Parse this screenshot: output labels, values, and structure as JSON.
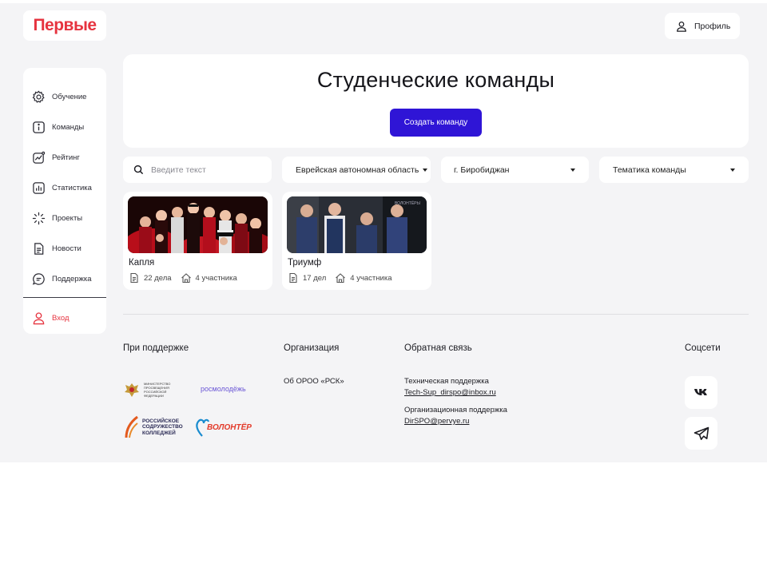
{
  "brand": {
    "logo_text": "Первые",
    "logo_color": "#e6333f"
  },
  "header": {
    "profile_label": "Профиль"
  },
  "sidebar": {
    "items": [
      {
        "label": "Обучение",
        "icon": "gear-icon"
      },
      {
        "label": "Команды",
        "icon": "info-icon"
      },
      {
        "label": "Рейтинг",
        "icon": "trend-chart-icon"
      },
      {
        "label": "Статистика",
        "icon": "bar-chart-icon"
      },
      {
        "label": "Проекты",
        "icon": "loader-icon"
      },
      {
        "label": "Новости",
        "icon": "document-icon"
      },
      {
        "label": "Поддержка",
        "icon": "chat-icon"
      }
    ],
    "login_label": "Вход"
  },
  "main": {
    "title": "Студенческие команды",
    "create_button": "Создать команду",
    "accent_color": "#2f15d6"
  },
  "filters": {
    "search_placeholder": "Введите текст",
    "region": "Еврейская автономная область",
    "city": "г. Биробиджан",
    "theme": "Тематика команды"
  },
  "teams": [
    {
      "name": "Капля",
      "cases": "22 дела",
      "members": "4 участника"
    },
    {
      "name": "Триумф",
      "cases": "17 дел",
      "members": "4 участника"
    }
  ],
  "footer": {
    "support_heading": "При поддержке",
    "org_heading": "Организация",
    "feedback_heading": "Обратная связь",
    "social_heading": "Соцсети",
    "org_link": "Об ОРОО «РСК»",
    "tech_support_label": "Техническая поддержка",
    "tech_support_email": "Tech-Sup_dirspo@inbox.ru",
    "org_support_label": "Организационная поддержка",
    "org_support_email": "DirSPO@pervye.ru",
    "partners": {
      "ministry": "МИНИСТЕРСТВО ПРОСВЕЩЕНИЯ РОССИЙСКОЙ ФЕДЕРАЦИИ",
      "rosmolodezh": "росмолодёжь",
      "colleges_line1": "РОССИЙСКОЕ",
      "colleges_line2": "СОДРУЖЕСТВО",
      "colleges_line3": "КОЛЛЕДЖЕЙ",
      "volunteer": "ВОЛОНТЁР"
    },
    "socials": [
      "vk-icon",
      "telegram-icon"
    ]
  }
}
